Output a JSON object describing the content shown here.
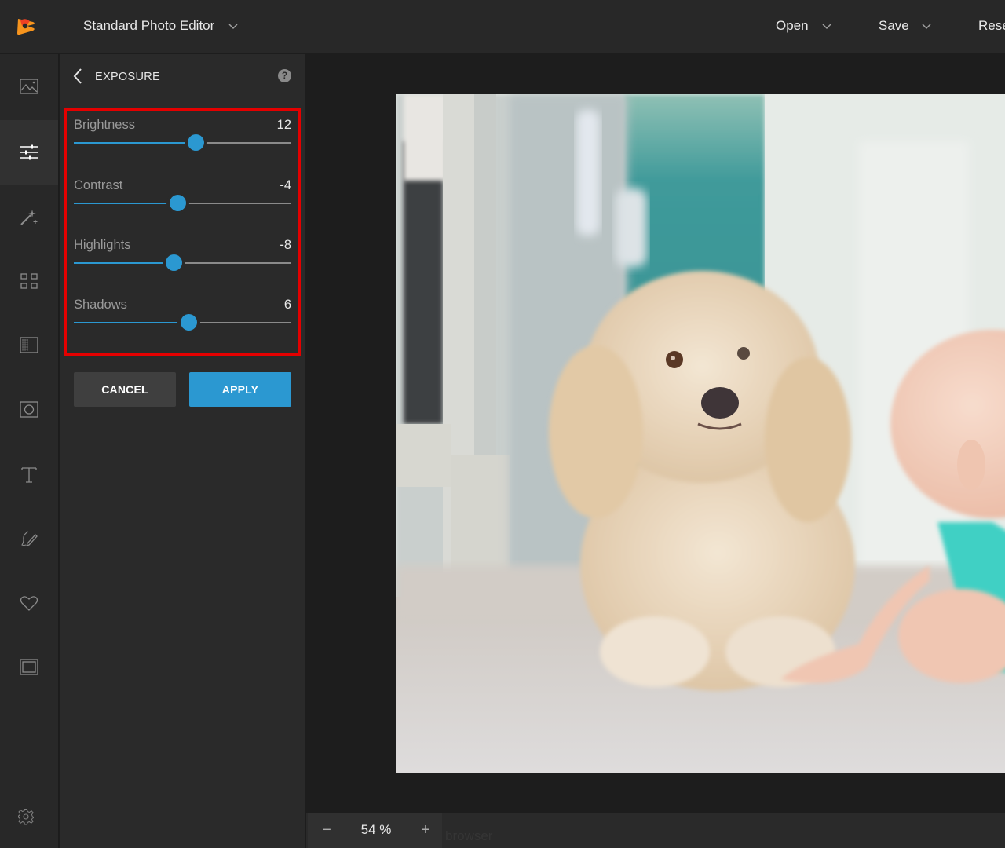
{
  "header": {
    "app_title": "Standard Photo Editor",
    "menus": [
      {
        "label": "Open"
      },
      {
        "label": "Save"
      },
      {
        "label": "Rese"
      }
    ]
  },
  "rail": {
    "items": [
      {
        "icon": "image-icon",
        "active": false
      },
      {
        "icon": "sliders-icon",
        "active": true
      },
      {
        "icon": "magic-wand-icon",
        "active": false
      },
      {
        "icon": "grid-icon",
        "active": false
      },
      {
        "icon": "texture-icon",
        "active": false
      },
      {
        "icon": "vignette-icon",
        "active": false
      },
      {
        "icon": "text-icon",
        "active": false
      },
      {
        "icon": "draw-icon",
        "active": false
      },
      {
        "icon": "heart-icon",
        "active": false
      },
      {
        "icon": "frame-icon",
        "active": false
      }
    ],
    "settings_icon": "gear-icon"
  },
  "panel": {
    "title": "EXPOSURE",
    "help_label": "?",
    "slider_range": [
      -100,
      100
    ],
    "sliders": [
      {
        "label": "Brightness",
        "value": 12
      },
      {
        "label": "Contrast",
        "value": -4
      },
      {
        "label": "Highlights",
        "value": -8
      },
      {
        "label": "Shadows",
        "value": 6
      }
    ],
    "cancel_label": "CANCEL",
    "apply_label": "APPLY"
  },
  "colors": {
    "accent": "#2b98d1",
    "highlight_border": "#e40000",
    "logo_orange": "#f7941d",
    "logo_red": "#ef4123"
  },
  "canvas": {
    "photo_description": "fluffy cream dog and baby on carpet"
  },
  "footer": {
    "zoom_minus": "−",
    "zoom_value": "54 %",
    "zoom_plus": "+",
    "ghost_text": "browser"
  }
}
